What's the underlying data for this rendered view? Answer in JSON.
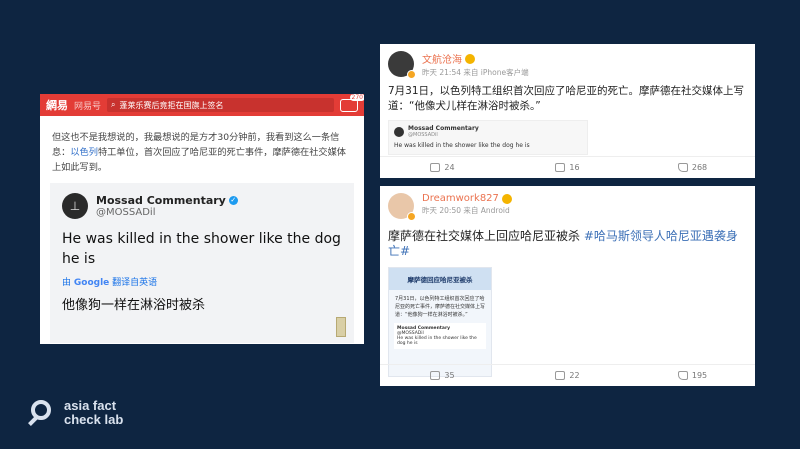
{
  "left": {
    "logo": "網易",
    "section": "网易号",
    "search_text": "蓬莱乐赛后竟拒在国旗上签名",
    "msg_badge": "270",
    "article_pre": "但这也不是我想说的，我最想说的是方才30分钟前，我看到这么一条信息：",
    "article_link": "以色列",
    "article_post": "特工单位，首次回应了哈尼亚的死亡事件，摩萨德在社交媒体上如此写到。",
    "tweet": {
      "name": "Mossad Commentary",
      "handle": "@MOSSADil",
      "text": "He was killed in the shower like the dog he is",
      "translate_prefix": "由",
      "translate_brand": "Google",
      "translate_suffix": "翻译自英语",
      "cn_text": "他像狗一样在淋浴时被杀"
    }
  },
  "post1": {
    "user": "文航沧海",
    "meta": "昨天 21:54 来自 iPhone客户端",
    "text": "7月31日，以色列特工组织首次回应了哈尼亚的死亡。摩萨德在社交媒体上写道：“他像犬儿样在淋浴时被杀。”",
    "repost_name": "Mossad Commentary",
    "repost_handle": "@MOSSADil",
    "repost_text": "He was killed in the shower like the dog he is",
    "reposts": "24",
    "comments": "16",
    "likes": "268"
  },
  "post2": {
    "user": "Dreamwork827",
    "meta": "昨天 20:50 来自 Android",
    "text": "摩萨德在社交媒体上回应哈尼亚被杀",
    "hashtag": "#哈马斯领导人哈尼亚遇袭身亡#",
    "image": {
      "title": "摩萨德回应哈尼亚被杀",
      "text": "7月31日，以色列特工组织首次回应了哈尼亚的死亡事件，摩萨德在社交媒体上写道：“他像狗一样在淋浴时被杀。”",
      "tweet_name": "Mossad Commentary",
      "tweet_handle": "@MOSSADil",
      "tweet_text": "He was killed in the shower like the dog he is"
    },
    "reposts": "35",
    "comments": "22",
    "likes": "195"
  },
  "brand": {
    "line1": "asia fact",
    "line2": "check lab"
  }
}
